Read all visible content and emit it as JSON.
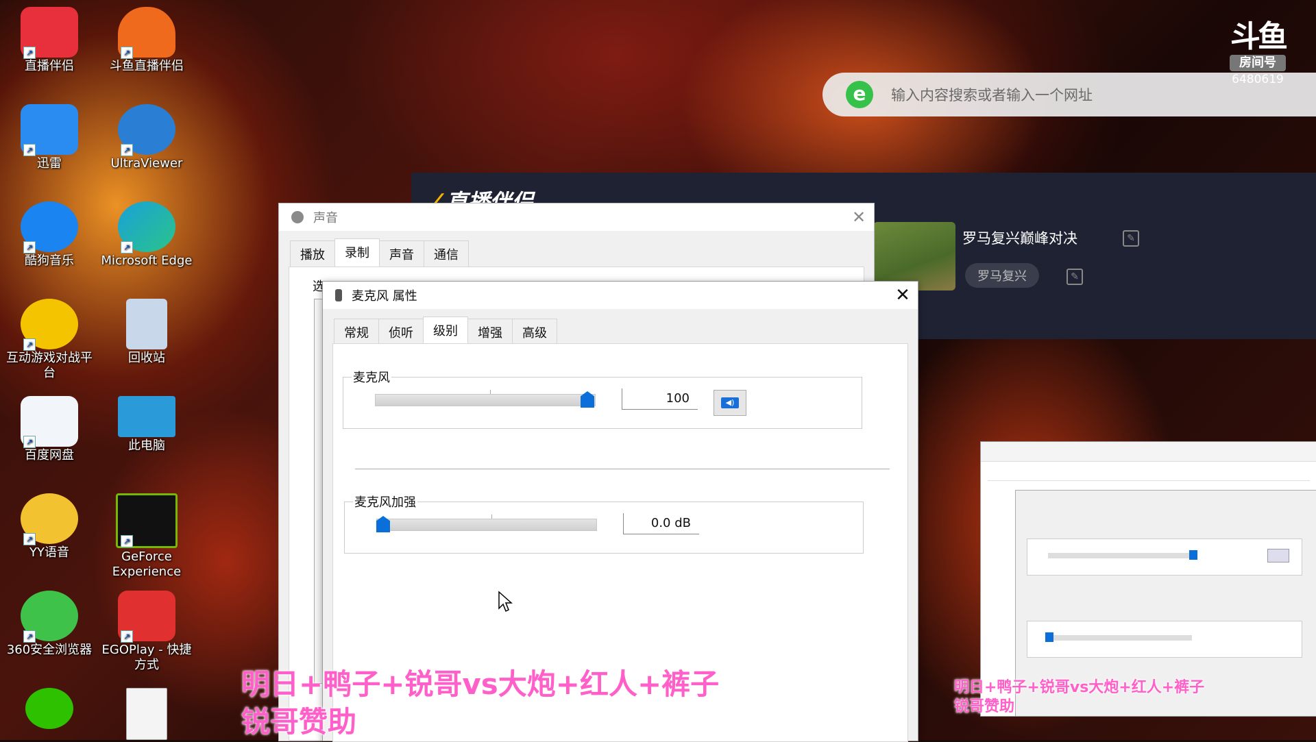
{
  "desktop": {
    "icons": [
      {
        "label": "直播伴侣",
        "name": "zhibo-banlv-icon",
        "color": "#e8303c"
      },
      {
        "label": "斗鱼直播伴侣",
        "name": "douyu-banlv-icon",
        "color": "#f06a1e"
      },
      {
        "label": "迅雷",
        "name": "xunlei-icon",
        "color": "#2a8cf0"
      },
      {
        "label": "UltraViewer",
        "name": "ultraviewer-icon",
        "color": "#2a7fd4"
      },
      {
        "label": "酷狗音乐",
        "name": "kugou-icon",
        "color": "#1a84f0"
      },
      {
        "label": "Microsoft Edge",
        "name": "edge-icon",
        "color": "#1aa0d8"
      },
      {
        "label": "互动游戏对战平台",
        "name": "game-platform-icon",
        "color": "#f4c400"
      },
      {
        "label": "回收站",
        "name": "recycle-bin-icon",
        "color": "#c8d8ea"
      },
      {
        "label": "百度网盘",
        "name": "baidu-netdisk-icon",
        "color": "#f2f6fb"
      },
      {
        "label": "此电脑",
        "name": "this-pc-icon",
        "color": "#2a9ad8"
      },
      {
        "label": "YY语音",
        "name": "yy-icon",
        "color": "#f2c230"
      },
      {
        "label": "GeForce Experience",
        "name": "geforce-icon",
        "color": "#76b900"
      },
      {
        "label": "360安全浏览器",
        "name": "360-browser-icon",
        "color": "#3ec24a"
      },
      {
        "label": "EGOPlay - 快捷方式",
        "name": "egoplay-icon",
        "color": "#e03030"
      },
      {
        "label": "",
        "name": "wechat-icon",
        "color": "#2dc100"
      },
      {
        "label": "",
        "name": "text-file-icon",
        "color": "#f4f4f4"
      }
    ]
  },
  "search": {
    "placeholder": "输入内容搜索或者输入一个网址",
    "logo": "e"
  },
  "douyu_badge": {
    "mark": "斗鱼",
    "room_label": "房间号",
    "room_number": "6480619"
  },
  "live_panel": {
    "brand": "直播伴侣",
    "title": "罗马复兴巅峰对决",
    "tag": "罗马复兴"
  },
  "sound_dialog": {
    "title": "声音",
    "tabs": [
      "播放",
      "录制",
      "声音",
      "通信"
    ],
    "active_tab": "录制",
    "select_prefix": "选"
  },
  "mic_dialog": {
    "title": "麦克风 属性",
    "tabs": [
      "常规",
      "侦听",
      "级别",
      "增强",
      "高级"
    ],
    "active_tab": "级别",
    "mic_group_label": "麦克风",
    "mic_value": "100",
    "mic_level_fraction": 1.0,
    "boost_group_label": "麦克风加强",
    "boost_value": "0.0 dB",
    "boost_level_fraction": 0.0
  },
  "overlay": {
    "line1": "明日+鸭子+锐哥vs大炮+红人+裤子",
    "line2": "锐哥赞助"
  }
}
